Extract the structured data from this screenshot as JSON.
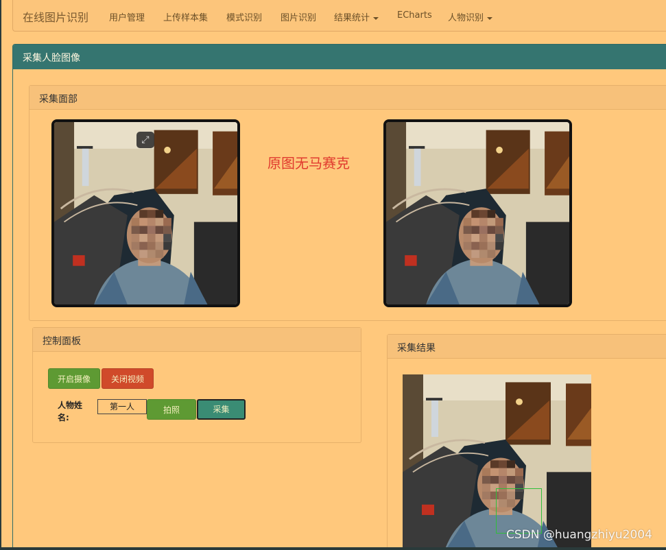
{
  "navbar": {
    "brand": "在线图片识别",
    "items": [
      {
        "label": "用户管理",
        "dropdown": false
      },
      {
        "label": "上传样本集",
        "dropdown": false
      },
      {
        "label": "模式识别",
        "dropdown": false
      },
      {
        "label": "图片识别",
        "dropdown": false
      },
      {
        "label": "结果统计",
        "dropdown": true
      },
      {
        "label": "ECharts",
        "dropdown": false
      },
      {
        "label": "人物识别",
        "dropdown": true
      }
    ]
  },
  "main_panel": {
    "title": "采集人脸图像"
  },
  "capture_panel": {
    "title": "采集面部",
    "annotation": "原图无马赛克",
    "expand_icon": "expand-icon"
  },
  "control_panel": {
    "title": "控制面板",
    "open_camera": "开启摄像",
    "close_video": "关闭视频",
    "name_label": "人物姓名:",
    "name_value": "第一人",
    "photo_button": "拍照",
    "collect_button": "采集"
  },
  "result_panel": {
    "title": "采集结果"
  },
  "watermark": "CSDN @huangzhiyu2004",
  "colors": {
    "page_bg": "#ffc87c",
    "header_teal": "#357570",
    "btn_green": "#5e9a33",
    "btn_red": "#d04a2a",
    "btn_teal": "#3a8c74",
    "annotation_red": "#e03a2e"
  }
}
